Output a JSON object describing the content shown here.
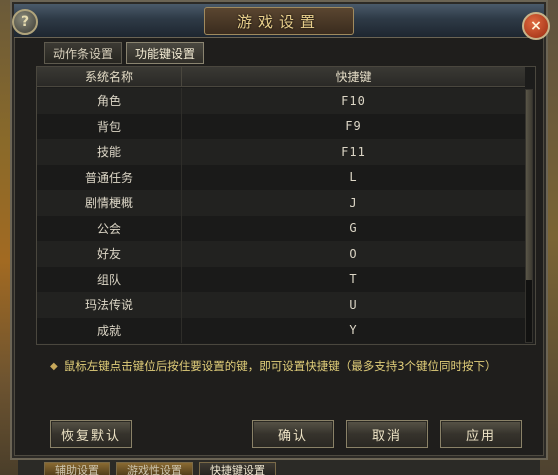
{
  "window": {
    "title": "游戏设置"
  },
  "buttons": {
    "help": "?",
    "close": "×"
  },
  "tabs": [
    {
      "label": "动作条设置",
      "active": false
    },
    {
      "label": "功能键设置",
      "active": true
    }
  ],
  "table": {
    "headers": [
      "系统名称",
      "快捷键"
    ],
    "rows": [
      {
        "name": "角色",
        "key": "F10"
      },
      {
        "name": "背包",
        "key": "F9"
      },
      {
        "name": "技能",
        "key": "F11"
      },
      {
        "name": "普通任务",
        "key": "L"
      },
      {
        "name": "剧情梗概",
        "key": "J"
      },
      {
        "name": "公会",
        "key": "G"
      },
      {
        "name": "好友",
        "key": "O"
      },
      {
        "name": "组队",
        "key": "T"
      },
      {
        "name": "玛法传说",
        "key": "U"
      },
      {
        "name": "成就",
        "key": "Y"
      }
    ]
  },
  "hint": "鼠标左键点击键位后按住要设置的键，即可设置快捷键（最多支持3个键位同时按下）",
  "actions": {
    "reset": "恢复默认",
    "ok": "确认",
    "cancel": "取消",
    "apply": "应用"
  },
  "bottom_tabs": [
    {
      "label": "辅助设置",
      "active": false
    },
    {
      "label": "游戏性设置",
      "active": false
    },
    {
      "label": "快捷键设置",
      "active": true
    }
  ]
}
